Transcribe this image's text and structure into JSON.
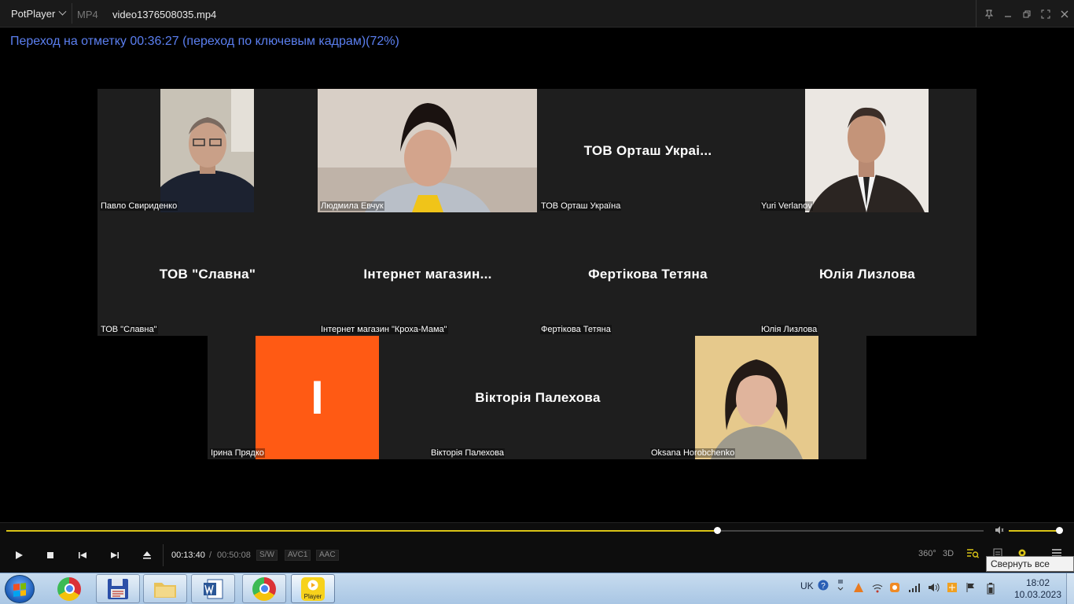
{
  "titlebar": {
    "app_name": "PotPlayer",
    "format": "MP4",
    "filename": "video1376508035.mp4"
  },
  "osd": {
    "message": "Переход на отметку 00:36:27 (переход по ключевым кадрам)(72%)"
  },
  "participants": {
    "row1": [
      {
        "label": "Павло Свириденко",
        "has_video": true
      },
      {
        "label": "Людмила Евчук",
        "has_video": true
      },
      {
        "label": "ТОВ Орташ Україна",
        "display_name": "ТОВ Орташ Украі...",
        "has_video": false
      },
      {
        "label": "Yuri Verlanov",
        "has_video": true
      }
    ],
    "row2": [
      {
        "label": "ТОВ \"Славна\"",
        "display_name": "ТОВ \"Славна\"",
        "has_video": false
      },
      {
        "label": "Інтернет магазин \"Кроха-Мама\"",
        "display_name": "Інтернет  магазин...",
        "has_video": false
      },
      {
        "label": "Фертікова Тетяна",
        "display_name": "Фертікова Тетяна",
        "has_video": false
      },
      {
        "label": "Юлія Лизлова",
        "display_name": "Юлія Лизлова",
        "has_video": false
      }
    ],
    "row3": [
      {
        "label": "Ірина Прядко",
        "avatar_letter": "I",
        "avatar_color": "#ff5a14",
        "has_video": false
      },
      {
        "label": "Вікторія Палехова",
        "display_name": "Вікторія Палехова",
        "has_video": false
      },
      {
        "label": "Oksana Horobchenko",
        "has_video": true
      }
    ]
  },
  "player": {
    "position": "00:13:40",
    "divider": "/",
    "duration": "00:50:08",
    "progress_fraction": 0.727,
    "volume_fraction": 1.0,
    "badges": [
      "S/W",
      "AVC1",
      "AAC"
    ],
    "right_buttons": [
      "360°",
      "3D"
    ],
    "accent_color": "#d9c316"
  },
  "tooltip": {
    "text": "Свернуть все окна"
  },
  "taskbar": {
    "items": [
      "start-button",
      "chrome",
      "app-save",
      "explorer",
      "word",
      "chrome",
      "potplayer"
    ],
    "potplayer_label": "Player",
    "language": "UK",
    "time": "18:02",
    "date": "10.03.2023"
  }
}
